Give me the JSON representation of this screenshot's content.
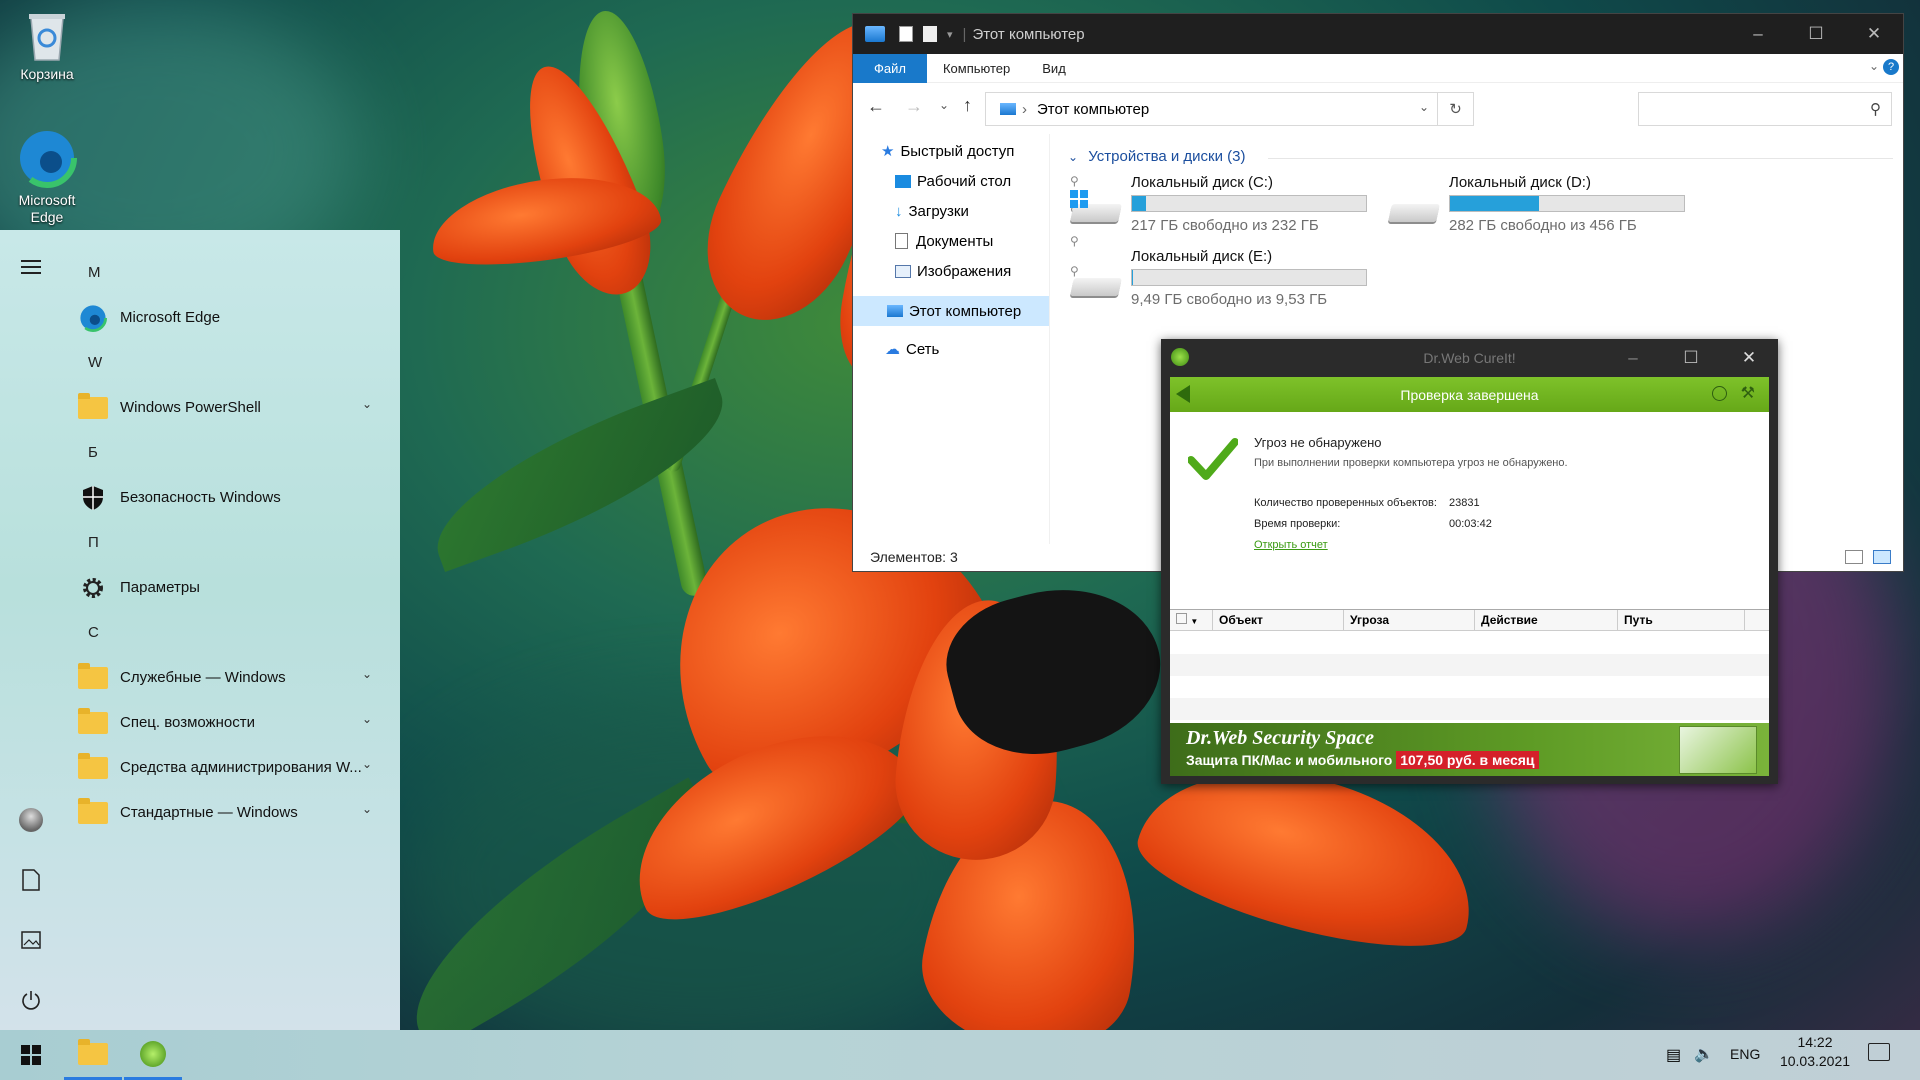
{
  "desktop": {
    "icons": [
      {
        "label": "Корзина",
        "icon": "recycle-bin-icon"
      },
      {
        "label": "Microsoft Edge",
        "icon": "edge-icon"
      }
    ]
  },
  "start_menu": {
    "letters": [
      "M",
      "W",
      "Б",
      "П",
      "С"
    ],
    "items": [
      {
        "label": "Microsoft Edge",
        "icon": "edge-icon"
      },
      {
        "label": "Windows PowerShell",
        "icon": "folder-icon"
      },
      {
        "label": "Безопасность Windows",
        "icon": "shield-icon"
      },
      {
        "label": "Параметры",
        "icon": "gear-icon"
      },
      {
        "label": "Служебные — Windows",
        "icon": "folder-icon"
      },
      {
        "label": "Спец. возможности",
        "icon": "folder-icon"
      },
      {
        "label": "Средства администрирования W...",
        "icon": "folder-icon"
      },
      {
        "label": "Стандартные — Windows",
        "icon": "folder-icon"
      }
    ]
  },
  "explorer": {
    "title": "Этот компьютер",
    "ribbon_tabs": [
      "Файл",
      "Компьютер",
      "Вид"
    ],
    "address": "Этот компьютер",
    "nav": {
      "quick_access": "Быстрый доступ",
      "desktop": "Рабочий стол",
      "downloads": "Загрузки",
      "documents": "Документы",
      "pictures": "Изображения",
      "this_pc": "Этот компьютер",
      "network": "Сеть"
    },
    "group_header": "Устройства и диски (3)",
    "drives": [
      {
        "name": "Локальный диск (C:)",
        "free": "217 ГБ свободно из 232 ГБ",
        "used_fraction": 0.06
      },
      {
        "name": "Локальный диск (D:)",
        "free": "282 ГБ свободно из 456 ГБ",
        "used_fraction": 0.38
      },
      {
        "name": "Локальный диск (E:)",
        "free": "9,49 ГБ свободно из 9,53 ГБ",
        "used_fraction": 0.005
      }
    ],
    "status": "Элементов: 3"
  },
  "drweb": {
    "title": "Dr.Web CureIt!",
    "header": "Проверка завершена",
    "result_title": "Угроз не обнаружено",
    "result_desc": "При выполнении проверки компьютера угроз не обнаружено.",
    "objects_label": "Количество проверенных объектов:",
    "objects_value": "23831",
    "time_label": "Время проверки:",
    "time_value": "00:03:42",
    "report_link": "Открыть отчет",
    "table_columns": [
      "Объект",
      "Угроза",
      "Действие",
      "Путь"
    ],
    "banner_title": "Dr.Web Security Space",
    "banner_text": "Защита ПК/Mac и мобильного",
    "banner_price": "107,50 руб. в месяц"
  },
  "taskbar": {
    "language": "ENG",
    "time": "14:22",
    "date": "10.03.2021"
  },
  "colors": {
    "accent": "#1979ca",
    "drive_fill": "#26a0da",
    "drweb_green": "#6fb41f"
  }
}
